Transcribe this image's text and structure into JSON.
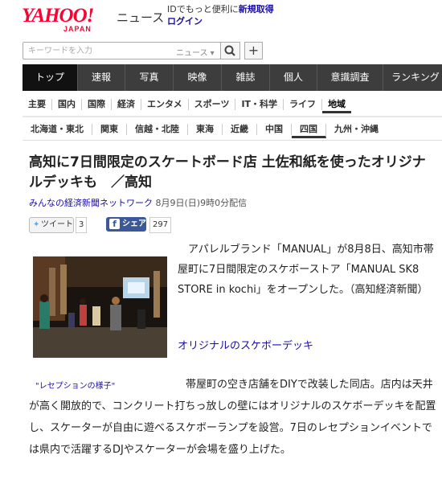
{
  "header": {
    "logo": "YAHOO!",
    "logo_sub": "JAPAN",
    "site_title": "ニュース",
    "promo_text": "IDでもっと便利に",
    "promo_link": "新規取得",
    "login": "ログイン"
  },
  "search": {
    "placeholder": "キーワードを入力",
    "scope": "ニュース ▾"
  },
  "main_nav": [
    "トップ",
    "速報",
    "写真",
    "映像",
    "雑誌",
    "個人",
    "意識調査",
    "ランキング"
  ],
  "sub_nav": [
    "主要",
    "国内",
    "国際",
    "経済",
    "エンタメ",
    "スポーツ",
    "IT・科学",
    "ライフ",
    "地域"
  ],
  "region_nav": [
    "北海道・東北",
    "関東",
    "信越・北陸",
    "東海",
    "近畿",
    "中国",
    "四国",
    "九州・沖縄"
  ],
  "article": {
    "headline": "高知に7日間限定のスケートボード店 土佐和紙を使ったオリジナルデッキも　／高知",
    "source": "みんなの経済新聞ネットワーク",
    "date": "8月9日(日)9時0分配信",
    "tweet_label": "ツイート",
    "tweet_count": "3",
    "share_label": "シェア",
    "share_count": "297",
    "caption": "\"レセプションの様子\"",
    "para1": "アパレルブランド「MANUAL」が8月8日、高知市帯屋町に7日間限定のスケボーストア「MANUAL SK8 STORE in kochi」をオープンした。（高知経済新聞）",
    "subhead_link": "オリジナルのスケボーデッキ",
    "para2": "帯屋町の空き店舗をDIYで改装した同店。店内は天井が高く開放的で、コンクリート打ちっ放しの壁にはオリジナルのスケボーデッキを配置し、スケーターが自由に遊べるスケボーランプを設営。7日のレセプションイベントでは県内で活躍するDJやスケーターが会場を盛り上げた。"
  }
}
